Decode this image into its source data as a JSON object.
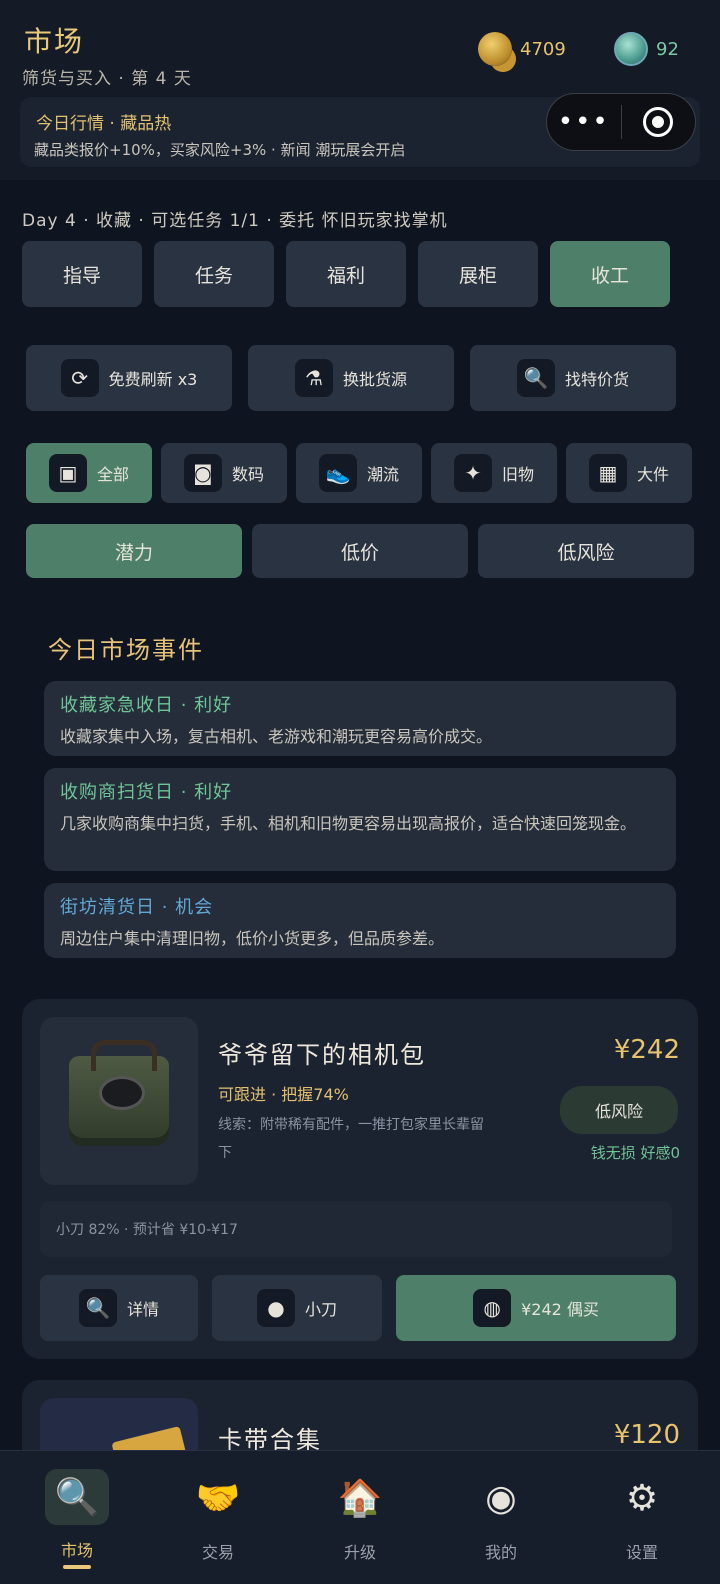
{
  "header": {
    "title": "市场",
    "subtitle": "筛货与买入 · 第 4 天",
    "coins": "4709",
    "gems": "92",
    "news_title": "今日行情 · 藏品热",
    "news_text": "藏品类报价+10%，买家风险+3% · 新闻 潮玩展会开启"
  },
  "capsule": {
    "more": "•••"
  },
  "day_line": "Day 4 · 收藏 · 可选任务 1/1 · 委托 怀旧玩家找掌机",
  "main_nav": {
    "guide": "指导",
    "task": "任务",
    "welfare": "福利",
    "showcase": "展柜",
    "close": "收工"
  },
  "actions": {
    "refresh": "免费刷新 x3",
    "switch": "换批货源",
    "find": "找特价货"
  },
  "categories": {
    "all": "全部",
    "digital": "数码",
    "trendy": "潮流",
    "old": "旧物",
    "big": "大件"
  },
  "sort": {
    "potential": "潜力",
    "low_price": "低价",
    "low_risk": "低风险"
  },
  "events": {
    "title": "今日市场事件",
    "items": [
      {
        "title": "收藏家急收日 · 利好",
        "desc": "收藏家集中入场，复古相机、老游戏和潮玩更容易高价成交。"
      },
      {
        "title": "收购商扫货日 · 利好",
        "desc": "几家收购商集中扫货，手机、相机和旧物更容易出现高报价，适合快速回笼现金。"
      },
      {
        "title": "街坊清货日 · 机会",
        "desc": "周边住户集中清理旧物，低价小货更多，但品质参差。"
      }
    ]
  },
  "item1": {
    "name": "爷爷留下的相机包",
    "tag": "可跟进 · 把握74%",
    "clue": "线索：附带稀有配件，一推打包家里长辈留下",
    "price": "¥242",
    "risk": "低风险",
    "status": "钱无损 好感0",
    "note": "小刀 82% · 预计省 ¥10-¥17",
    "btn_detail": "详情",
    "btn_bargain": "小刀",
    "btn_buy": "¥242 偶买"
  },
  "item2": {
    "name": "卡带合集",
    "price": "¥120"
  },
  "tabbar": {
    "market": "市场",
    "trade": "交易",
    "upgrade": "升级",
    "mine": "我的",
    "settings": "设置"
  },
  "colors": {
    "accent_gold": "#e7c36e",
    "accent_green": "#4e8069",
    "good_green": "#6fc596",
    "info_blue": "#62a8d6",
    "background": "#0f1520"
  }
}
